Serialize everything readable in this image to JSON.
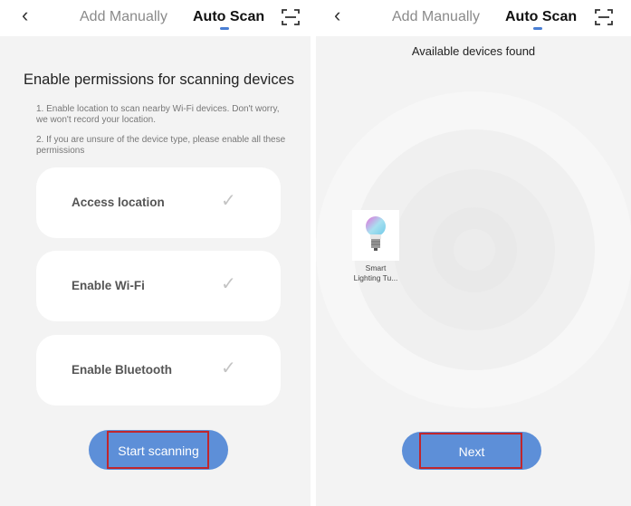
{
  "left": {
    "header": {
      "back_icon": "chevron-left-icon",
      "tab_manual": "Add Manually",
      "tab_auto": "Auto Scan",
      "scan_icon": "scan-frame-icon",
      "accent": "#4a7fd4"
    },
    "title": "Enable permissions for scanning devices",
    "notes": [
      "1. Enable location to scan nearby Wi-Fi devices. Don't worry, we won't record your location.",
      "2. If you are unsure of the device type, please enable all these permissions"
    ],
    "permissions": [
      {
        "label": "Access location",
        "check": "✓"
      },
      {
        "label": "Enable Wi-Fi",
        "check": "✓"
      },
      {
        "label": "Enable Bluetooth",
        "check": "✓"
      }
    ],
    "start_button": "Start scanning"
  },
  "right": {
    "header": {
      "back_icon": "chevron-left-icon",
      "tab_manual": "Add Manually",
      "tab_auto": "Auto Scan",
      "scan_icon": "scan-frame-icon"
    },
    "found_title": "Available devices found",
    "device": {
      "icon": "smart-bulb-icon",
      "label_line1": "Smart",
      "label_line2": "Lighting Tu..."
    },
    "next_button": "Next"
  },
  "colors": {
    "button": "#5d8fd8",
    "highlight_box": "#c0262d",
    "background": "#f3f3f3"
  }
}
